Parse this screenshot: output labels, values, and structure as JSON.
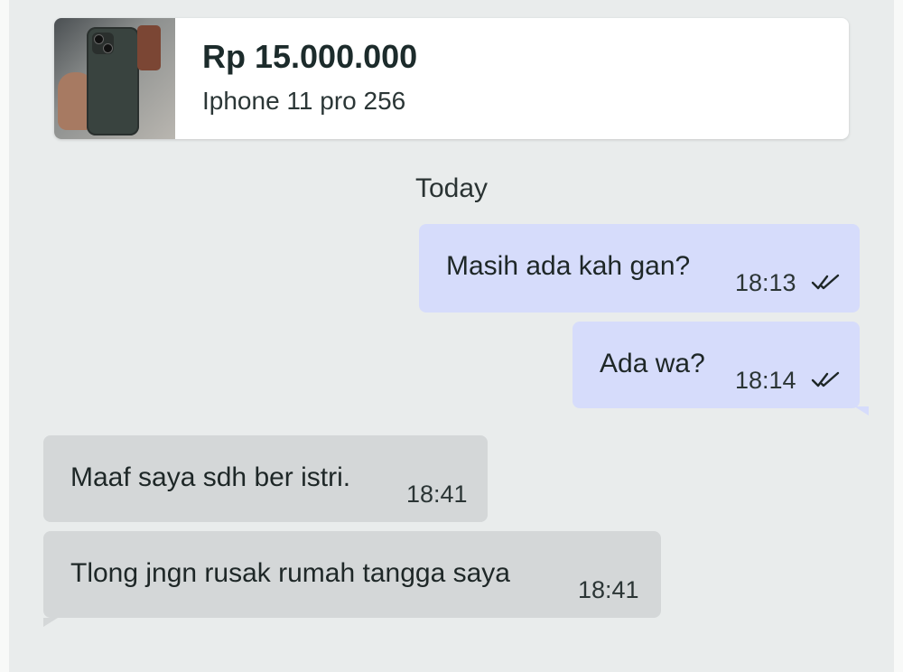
{
  "product": {
    "price": "Rp 15.000.000",
    "name": "Iphone 11 pro 256",
    "thumbnail_icon": "phone-photo"
  },
  "date_divider": "Today",
  "messages": [
    {
      "direction": "outgoing",
      "text": "Masih ada kah gan?",
      "time": "18:13",
      "status": "read"
    },
    {
      "direction": "outgoing",
      "text": "Ada wa?",
      "time": "18:14",
      "status": "read"
    },
    {
      "direction": "incoming",
      "text": "Maaf saya sdh ber istri.",
      "time": "18:41"
    },
    {
      "direction": "incoming",
      "text": "Tlong jngn rusak rumah tangga saya",
      "time": "18:41"
    }
  ],
  "colors": {
    "chat_background": "#e9ecec",
    "outgoing_bubble": "#d6dcfb",
    "incoming_bubble": "#d4d7d8",
    "card_background": "#ffffff"
  }
}
